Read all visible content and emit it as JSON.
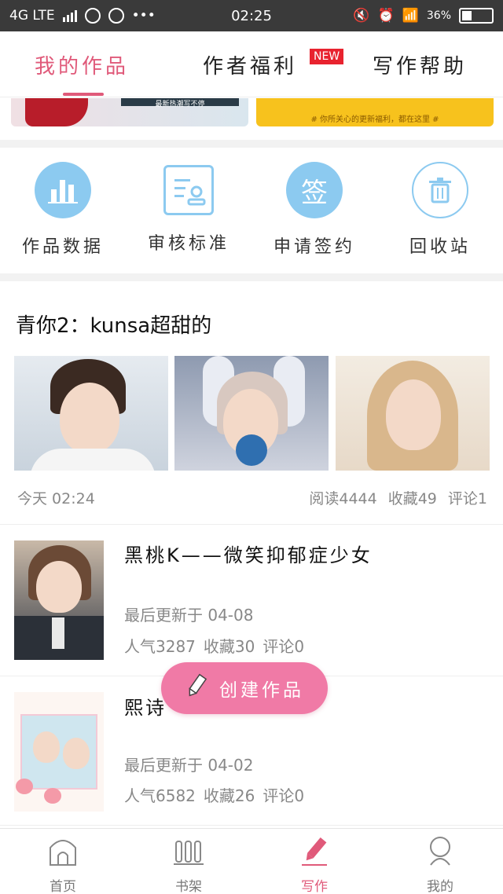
{
  "status_bar": {
    "network": "4G LTE",
    "time": "02:25",
    "battery": "36%"
  },
  "top_tabs": {
    "mine": "我的作品",
    "welfare": "作者福利",
    "new_badge": "NEW",
    "help": "写作帮助"
  },
  "banners": {
    "left_caption": "最新热潮写不停",
    "right_caption": "# 你所关心的更新福利，都在这里 #"
  },
  "quick_actions": [
    {
      "label": "作品数据",
      "icon": "bar-chart-icon"
    },
    {
      "label": "审核标准",
      "icon": "document-user-icon"
    },
    {
      "label": "申请签约",
      "icon": "sign-icon"
    },
    {
      "label": "回收站",
      "icon": "trash-icon"
    }
  ],
  "sign_glyph": "签",
  "featured": {
    "title": "青你2：kunsa超甜的",
    "time": "今天 02:24",
    "reads": "阅读4444",
    "favorites": "收藏49",
    "comments": "评论1"
  },
  "works": [
    {
      "title": "黑桃K——微笑抑郁症少女",
      "updated": "最后更新于 04-08",
      "popularity": "人气3287",
      "favorites": "收藏30",
      "comments": "评论0"
    },
    {
      "title": "熙诗",
      "updated": "最后更新于 04-02",
      "popularity": "人气6582",
      "favorites": "收藏26",
      "comments": "评论0"
    }
  ],
  "create_button": "创建作品",
  "bottom_nav": {
    "home": "首页",
    "shelf": "书架",
    "write": "写作",
    "me": "我的"
  },
  "colors": {
    "accent": "#e05a7a",
    "icon_blue": "#8ccaf0",
    "create_pink": "#f07aa6"
  }
}
